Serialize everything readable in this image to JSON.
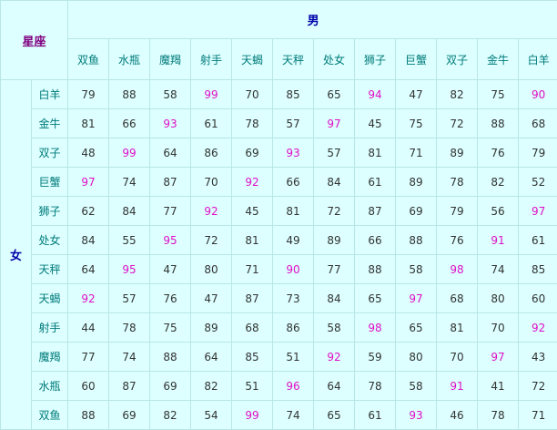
{
  "corner_label": "星座",
  "male_label": "男",
  "female_label": "女",
  "columns": [
    "双鱼",
    "水瓶",
    "魔羯",
    "射手",
    "天蝎",
    "天秤",
    "处女",
    "狮子",
    "巨蟹",
    "双子",
    "金牛",
    "白羊"
  ],
  "rows": [
    {
      "sign": "白羊",
      "values": [
        79,
        88,
        58,
        99,
        70,
        85,
        65,
        94,
        47,
        82,
        75,
        90
      ],
      "highlight": [
        3,
        7,
        11
      ]
    },
    {
      "sign": "金牛",
      "values": [
        81,
        66,
        93,
        61,
        78,
        57,
        97,
        45,
        75,
        72,
        88,
        68
      ],
      "highlight": [
        2,
        6
      ]
    },
    {
      "sign": "双子",
      "values": [
        48,
        99,
        64,
        86,
        69,
        93,
        57,
        81,
        71,
        89,
        76,
        79
      ],
      "highlight": [
        1,
        5
      ]
    },
    {
      "sign": "巨蟹",
      "values": [
        97,
        74,
        87,
        70,
        92,
        66,
        84,
        61,
        89,
        78,
        82,
        52
      ],
      "highlight": [
        0,
        4
      ]
    },
    {
      "sign": "狮子",
      "values": [
        62,
        84,
        77,
        92,
        45,
        81,
        72,
        87,
        69,
        79,
        56,
        97
      ],
      "highlight": [
        3,
        11
      ]
    },
    {
      "sign": "处女",
      "values": [
        84,
        55,
        95,
        72,
        81,
        49,
        89,
        66,
        88,
        76,
        91,
        61
      ],
      "highlight": [
        2,
        10
      ]
    },
    {
      "sign": "天秤",
      "values": [
        64,
        95,
        47,
        80,
        71,
        90,
        77,
        88,
        58,
        98,
        74,
        85
      ],
      "highlight": [
        1,
        5,
        9
      ]
    },
    {
      "sign": "天蝎",
      "values": [
        92,
        57,
        76,
        47,
        87,
        73,
        84,
        65,
        97,
        68,
        80,
        60
      ],
      "highlight": [
        0,
        8
      ]
    },
    {
      "sign": "射手",
      "values": [
        44,
        78,
        75,
        89,
        68,
        86,
        58,
        98,
        65,
        81,
        70,
        92
      ],
      "highlight": [
        7,
        11
      ]
    },
    {
      "sign": "魔羯",
      "values": [
        77,
        74,
        88,
        64,
        85,
        51,
        92,
        59,
        80,
        70,
        97,
        43
      ],
      "highlight": [
        6,
        10
      ]
    },
    {
      "sign": "水瓶",
      "values": [
        60,
        87,
        69,
        82,
        51,
        96,
        64,
        78,
        58,
        91,
        41,
        72
      ],
      "highlight": [
        5,
        9
      ]
    },
    {
      "sign": "双鱼",
      "values": [
        88,
        69,
        82,
        54,
        99,
        74,
        65,
        61,
        93,
        46,
        78,
        71
      ],
      "highlight": [
        4,
        8
      ]
    }
  ],
  "colors": {
    "background": "#ddffff",
    "border": "#b8e6e6",
    "header": "#0000aa",
    "corner": "#800080",
    "sign_text": "#007a7a",
    "value_text": "#333333",
    "highlight_text": "#e010c8"
  }
}
